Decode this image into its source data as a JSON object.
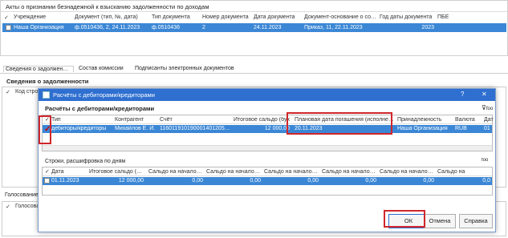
{
  "bg": {
    "title": "Акты о признании безнадежной к взысканию задолженности по доходам",
    "cols": [
      "Учреждение",
      "Документ (тип, №, дата)",
      "Тип документа",
      "Номер документа",
      "Дата документа",
      "Документ-основание о созда",
      "Год даты документа",
      "ПБЕ"
    ],
    "row": [
      "Наша Организация",
      "ф.0510436, 2, 24.11.2023",
      "ф.0510436",
      "2",
      "24.11.2023",
      "Приказ, 11, 22.11.2023",
      "2023",
      ""
    ],
    "tabs": [
      "Сведения о задолженности",
      "Состав комиссии",
      "Подписанты электронных документов"
    ],
    "section": "Сведения о задолженности",
    "left_col": "Код строк",
    "bottom_title": "Голосование",
    "bottom_col": "Голосова"
  },
  "dialog": {
    "title": "Расчёты с дебиторами/кредиторами",
    "help": "?",
    "close": "✕",
    "grid_title": "Расчёты с дебиторами/кредиторами",
    "cols": [
      "Тип",
      "Контрагент",
      "Счёт",
      "Итоговое сальдо (бух",
      "Плановая дата погашения (исполнения)",
      "Принадлежность",
      "Валюта",
      "Дат"
    ],
    "row": [
      "дебиторы/кредиторы",
      "Михайлов Е. И.",
      "11601191019000140120545000",
      "12 000,00",
      "20.11.2023",
      "Наша Организация",
      "RUB",
      "01"
    ],
    "rows_title": "Строки, расшифровка по дням",
    "rows_cols": [
      "Дата",
      "Итоговое сальдо (бух",
      "Сальдо на начало дня",
      "Сальдо на начало дня",
      "Сальдо на начало дня",
      "Сальдо на начало дня",
      "Сальдо на начало дня",
      "Сальдо на"
    ],
    "rows_row": [
      "01.11.2023",
      "12 000,00",
      "0,00",
      "0,00",
      "0,00",
      "0,00",
      "0,00",
      "0,0"
    ],
    "ok": "ОК",
    "cancel": "Отмена",
    "help_btn": "Справка"
  }
}
